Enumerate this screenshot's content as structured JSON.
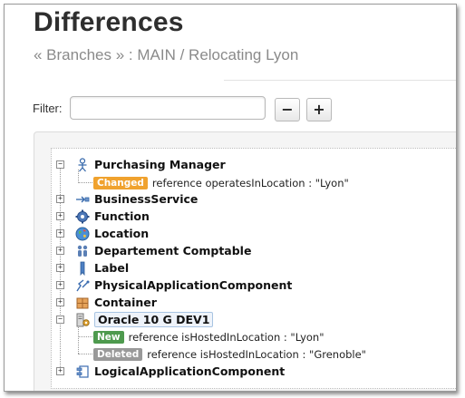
{
  "page": {
    "title": "Differences",
    "breadcrumb": {
      "branches": "« Branches »",
      "rest": ": MAIN / Relocating Lyon"
    }
  },
  "filter": {
    "label": "Filter:",
    "value": "",
    "collapse_label": "−",
    "expand_label": "+"
  },
  "tree": {
    "nodes": [
      {
        "label": "Purchasing Manager",
        "icon": "actor-icon",
        "expanded": true,
        "children": [
          {
            "badge": "Changed",
            "text": "reference operatesInLocation : \"Lyon\""
          }
        ]
      },
      {
        "label": "BusinessService",
        "icon": "business-service-icon",
        "expanded": false
      },
      {
        "label": "Function",
        "icon": "function-gear-icon",
        "expanded": false
      },
      {
        "label": "Location",
        "icon": "location-globe-icon",
        "expanded": false
      },
      {
        "label": "Departement Comptable",
        "icon": "group-icon",
        "expanded": false
      },
      {
        "label": "Label",
        "icon": "label-bookmark-icon",
        "expanded": false
      },
      {
        "label": "PhysicalApplicationComponent",
        "icon": "physical-component-icon",
        "expanded": false
      },
      {
        "label": "Container",
        "icon": "container-icon",
        "expanded": false
      },
      {
        "label": "Oracle 10 G DEV1",
        "icon": "server-icon",
        "expanded": true,
        "selected": true,
        "children": [
          {
            "badge": "New",
            "text": "reference isHostedInLocation : \"Lyon\""
          },
          {
            "badge": "Deleted",
            "text": "reference isHostedInLocation : \"Grenoble\""
          }
        ]
      },
      {
        "label": "LogicalApplicationComponent",
        "icon": "logical-component-icon",
        "expanded": false
      }
    ]
  },
  "colors": {
    "changed": "#f0a22e",
    "new": "#4e9a4e",
    "deleted": "#999999"
  }
}
